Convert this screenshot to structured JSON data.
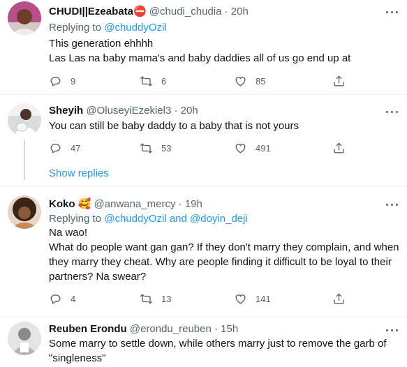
{
  "tweets": [
    {
      "name": "CHUDI||Ezeabata",
      "emoji": "⛔",
      "handle": "@chudi_chudia",
      "sep": "·",
      "time": "20h",
      "replying_prefix": "Replying to",
      "replying_to": "@chuddyOzil",
      "lines": [
        "This generation ehhhh",
        "Las Las na baby mama's and baby daddies all of us go end up at"
      ],
      "replies": "9",
      "retweets": "6",
      "likes": "85"
    },
    {
      "name": "Sheyih",
      "handle": "@OluseyiEzekiel3",
      "sep": "·",
      "time": "20h",
      "lines": [
        "You can still be baby daddy to a baby that is not yours"
      ],
      "replies": "47",
      "retweets": "53",
      "likes": "491",
      "show_replies": "Show replies"
    },
    {
      "name": "Koko",
      "emoji": "🥰",
      "handle": "@anwana_mercy",
      "sep": "·",
      "time": "19h",
      "replying_prefix": "Replying to",
      "replying_to": "@chuddyOzil",
      "replying_and": "and",
      "replying_to_2": "@doyin_deji",
      "lines": [
        "Na wao!",
        "What do people want gan gan? If they don't marry they complain, and when they marry they cheat. Why are people finding it difficult to be loyal to their partners? Na swear?"
      ],
      "replies": "4",
      "retweets": "13",
      "likes": "141"
    },
    {
      "name": "Reuben Erondu",
      "handle": "@erondu_reuben",
      "sep": "·",
      "time": "15h",
      "lines": [
        "Some marry to settle down, while others marry just to remove the garb of \"singleness\""
      ]
    }
  ],
  "icons": {
    "reply": "reply-icon",
    "retweet": "retweet-icon",
    "like": "heart-icon",
    "share": "share-icon",
    "more": "more-icon"
  },
  "colors": {
    "accent": "#1d9bf0",
    "secondary_text": "#536471",
    "divider": "#eff3f4"
  }
}
